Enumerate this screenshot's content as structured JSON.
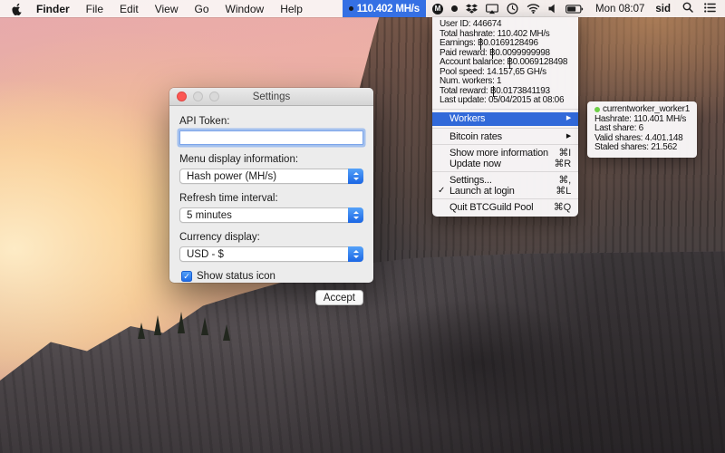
{
  "colors": {
    "selection_blue": "#3169d9",
    "menubar_item_blue": "#3570e4",
    "worker_status_green": "#6ecf46",
    "close_red": "#fc5753"
  },
  "menubar": {
    "app_name": "Finder",
    "menus": {
      "file": "File",
      "edit": "Edit",
      "view": "View",
      "go": "Go",
      "window": "Window",
      "help": "Help"
    },
    "status_value": "110.402 MH/s",
    "m_badge": "M",
    "clock": "Mon 08:07",
    "user": "sid"
  },
  "dropdown": {
    "info_lines": [
      {
        "label": "User ID: ",
        "value": "446674"
      },
      {
        "label": "Total hashrate: ",
        "value": "110.402 MH/s"
      },
      {
        "label": "Earnings: ",
        "symbol": "B",
        "value": "0.0169128496"
      },
      {
        "label": "Paid reward: ",
        "symbol": "B",
        "value": "0.0099999998"
      },
      {
        "label": "Account balance: ",
        "symbol": "B",
        "value": "0.0069128498"
      },
      {
        "label": "Pool speed: ",
        "value": "14.157,65 GH/s"
      },
      {
        "label": "Num. workers: ",
        "value": "1"
      },
      {
        "label": "Total reward: ",
        "symbol": "B",
        "value": "0.0173841193"
      },
      {
        "label": "Last update: ",
        "value": "05/04/2015 at 08:06"
      }
    ],
    "items": {
      "workers": "Workers",
      "bitcoin_rates": "Bitcoin rates",
      "show_more": "Show more information",
      "show_more_key": "⌘I",
      "update_now": "Update now",
      "update_now_key": "⌘R",
      "settings": "Settings...",
      "settings_key": "⌘,",
      "launch": "Launch at login",
      "launch_check": "✓",
      "launch_key": "⌘L",
      "quit": "Quit BTCGuild Pool",
      "quit_key": "⌘Q"
    },
    "submenu_arrow": "▶"
  },
  "submenu": {
    "title": "currentworker_worker1",
    "lines": [
      {
        "label": "Hashrate: ",
        "value": "110.401 MH/s"
      },
      {
        "label": "Last share: ",
        "value": "6"
      },
      {
        "label": "Valid shares: ",
        "value": "4.401.148"
      },
      {
        "label": "Staled shares: ",
        "value": "21.562"
      }
    ]
  },
  "settings_window": {
    "title": "Settings",
    "api_token_label": "API Token:",
    "api_token_value": "",
    "menu_display_label": "Menu display information:",
    "menu_display_value": "Hash power (MH/s)",
    "refresh_label": "Refresh time interval:",
    "refresh_value": "5 minutes",
    "currency_label": "Currency display:",
    "currency_value": "USD - $",
    "checkbox_label": "Show status icon",
    "checkbox_check": "✓",
    "accept_label": "Accept"
  }
}
